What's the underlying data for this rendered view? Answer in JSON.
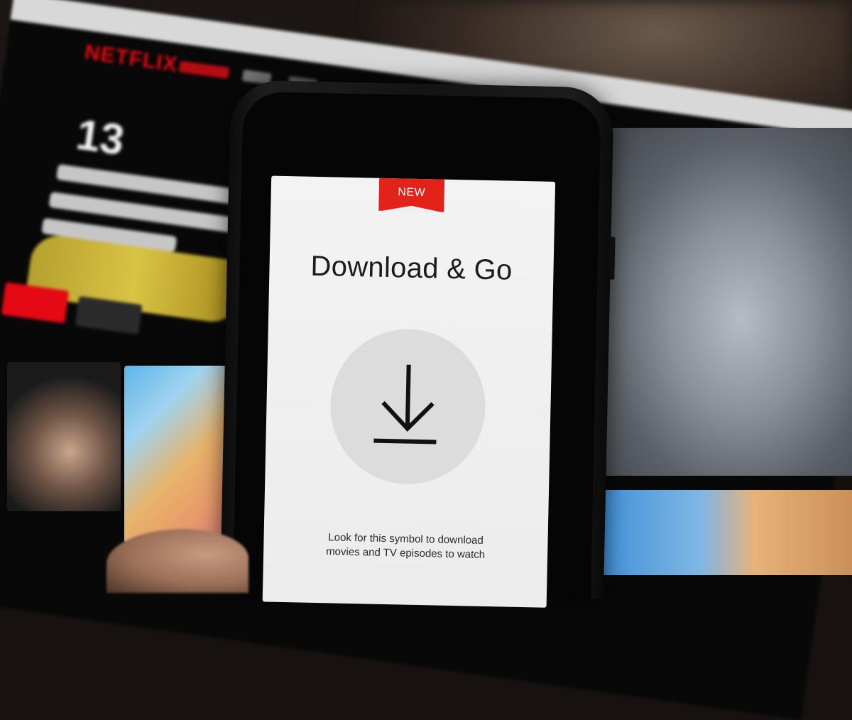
{
  "background_screen": {
    "brand": "NETFLIX",
    "count": "13",
    "brand_color": "#e50914"
  },
  "phone_screen": {
    "badge": "NEW",
    "title": "Download & Go",
    "icon": "download-icon",
    "description_lines": [
      "Look for this symbol to download",
      "movies and TV episodes to watch"
    ],
    "accent_color": "#e3221a"
  }
}
